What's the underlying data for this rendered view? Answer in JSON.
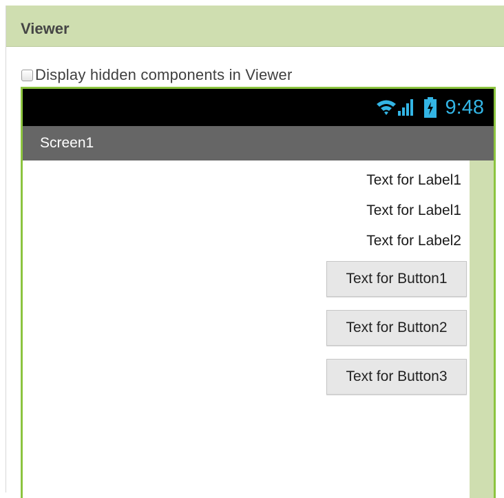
{
  "viewer": {
    "title": "Viewer",
    "hidden_components_label": "Display hidden components in Viewer",
    "hidden_components_checked": false
  },
  "device": {
    "status_bar": {
      "time": "9:48",
      "icons": [
        "wifi-icon",
        "signal-icon",
        "battery-charging-icon"
      ],
      "accent_color": "#33b5e5"
    },
    "screen_title": "Screen1",
    "components": {
      "labels": [
        "Text for Label1",
        "Text for Label1",
        "Text for Label2"
      ],
      "buttons": [
        "Text for Button1",
        "Text for Button2",
        "Text for Button3"
      ]
    }
  },
  "colors": {
    "header_bg": "#cfdeb0",
    "device_border": "#8cc43f",
    "title_bar_bg": "#666666",
    "status_bar_bg": "#000000"
  }
}
